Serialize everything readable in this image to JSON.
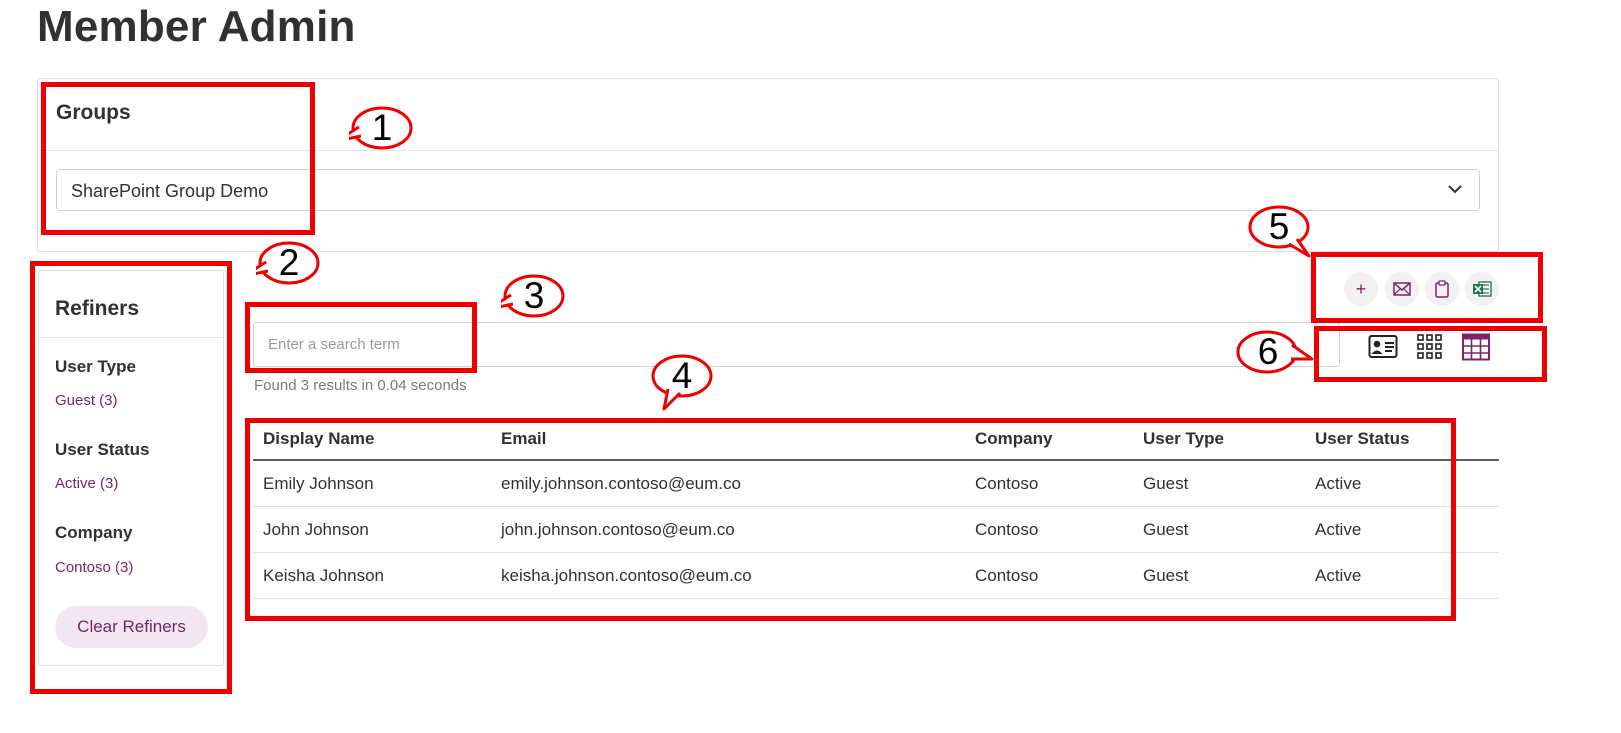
{
  "page": {
    "title": "Member Admin"
  },
  "groups": {
    "title": "Groups",
    "selected": "SharePoint Group Demo"
  },
  "refiners": {
    "title": "Refiners",
    "sections": [
      {
        "heading": "User Type",
        "options": [
          "Guest (3)"
        ]
      },
      {
        "heading": "User Status",
        "options": [
          "Active (3)"
        ]
      },
      {
        "heading": "Company",
        "options": [
          "Contoso (3)"
        ]
      }
    ],
    "clear_label": "Clear Refiners"
  },
  "search": {
    "placeholder": "Enter a search term",
    "value": "",
    "result_info": "Found 3 results in 0.04 seconds"
  },
  "actions": [
    {
      "name": "add-member",
      "icon": "plus-icon",
      "label": "+"
    },
    {
      "name": "email",
      "icon": "envelope-icon"
    },
    {
      "name": "copy",
      "icon": "clipboard-icon"
    },
    {
      "name": "export-excel",
      "icon": "excel-icon"
    }
  ],
  "views": [
    {
      "name": "card-view",
      "icon": "contact-card-icon"
    },
    {
      "name": "grid-view",
      "icon": "dot-grid-icon"
    },
    {
      "name": "table-view",
      "icon": "table-icon",
      "active": true
    }
  ],
  "table": {
    "headers": [
      "Display Name",
      "Email",
      "Company",
      "User Type",
      "User Status"
    ],
    "rows": [
      [
        "Emily Johnson",
        "emily.johnson.contoso@eum.co",
        "Contoso",
        "Guest",
        "Active"
      ],
      [
        "John Johnson",
        "john.johnson.contoso@eum.co",
        "Contoso",
        "Guest",
        "Active"
      ],
      [
        "Keisha Johnson",
        "keisha.johnson.contoso@eum.co",
        "Contoso",
        "Guest",
        "Active"
      ]
    ]
  },
  "annotations": [
    "1",
    "2",
    "3",
    "4",
    "5",
    "6"
  ],
  "colors": {
    "accent": "#7a2668",
    "annotation": "#ee0000",
    "excel": "#217346"
  }
}
